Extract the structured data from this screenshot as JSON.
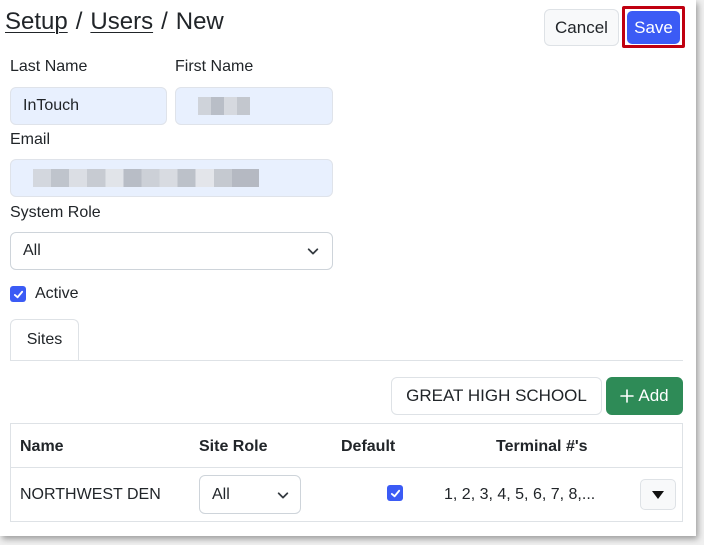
{
  "breadcrumb": {
    "setup": "Setup",
    "users": "Users",
    "current": "New",
    "separator": "/"
  },
  "toolbar": {
    "cancel_label": "Cancel",
    "save_label": "Save"
  },
  "form": {
    "last_name_label": "Last Name",
    "last_name_value": "InTouch",
    "first_name_label": "First Name",
    "email_label": "Email",
    "system_role_label": "System Role",
    "system_role_value": "All",
    "active_label": "Active",
    "active_checked": true
  },
  "tabs": [
    {
      "label": "Sites",
      "active": true
    }
  ],
  "sites": {
    "selected_site": "GREAT HIGH SCHOOL",
    "add_label": "Add",
    "columns": [
      "Name",
      "Site Role",
      "Default",
      "Terminal #'s"
    ],
    "rows": [
      {
        "name": "NORTHWEST DEN",
        "site_role": "All",
        "default": true,
        "terminals": "1, 2, 3, 4, 5, 6, 7, 8,..."
      }
    ]
  },
  "colors": {
    "primary": "#3b5bf5",
    "success": "#2e8b57",
    "input_fill": "#e8f0fe",
    "highlight": "#c00010"
  }
}
